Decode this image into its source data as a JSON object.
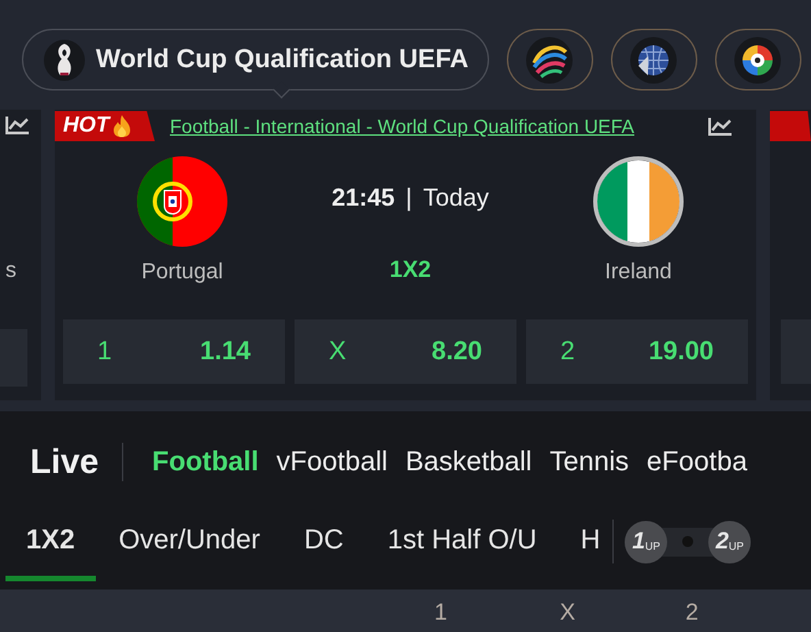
{
  "league_bar": {
    "title": "World Cup Qualification UEFA"
  },
  "matches": [
    {
      "kind": "partial-left",
      "team_tail": "s"
    },
    {
      "kind": "full",
      "hot": true,
      "hot_label": "HOT",
      "competition": "Football - International - World Cup Qualification UEFA",
      "time": "21:45",
      "separator": "|",
      "day": "Today",
      "home": "Portugal",
      "away": "Ireland",
      "market": "1X2",
      "odds": [
        {
          "label": "1",
          "price": "1.14"
        },
        {
          "label": "X",
          "price": "8.20"
        },
        {
          "label": "2",
          "price": "19.00"
        }
      ]
    },
    {
      "kind": "partial-right",
      "hot": true
    }
  ],
  "live": {
    "title": "Live"
  },
  "sports": [
    {
      "label": "Football",
      "selected": true
    },
    {
      "label": "vFootball",
      "selected": false
    },
    {
      "label": "Basketball",
      "selected": false
    },
    {
      "label": "Tennis",
      "selected": false
    },
    {
      "label": "eFootba",
      "selected": false
    }
  ],
  "markets": [
    {
      "label": "1X2",
      "selected": true
    },
    {
      "label": "Over/Under",
      "selected": false
    },
    {
      "label": "DC",
      "selected": false
    },
    {
      "label": "1st Half O/U",
      "selected": false
    },
    {
      "label": "H",
      "selected": false
    }
  ],
  "toggle": {
    "left": {
      "number": "1",
      "suffix": "UP"
    },
    "right": {
      "number": "2",
      "suffix": "UP"
    }
  },
  "columns": [
    "1",
    "X",
    "2"
  ]
}
